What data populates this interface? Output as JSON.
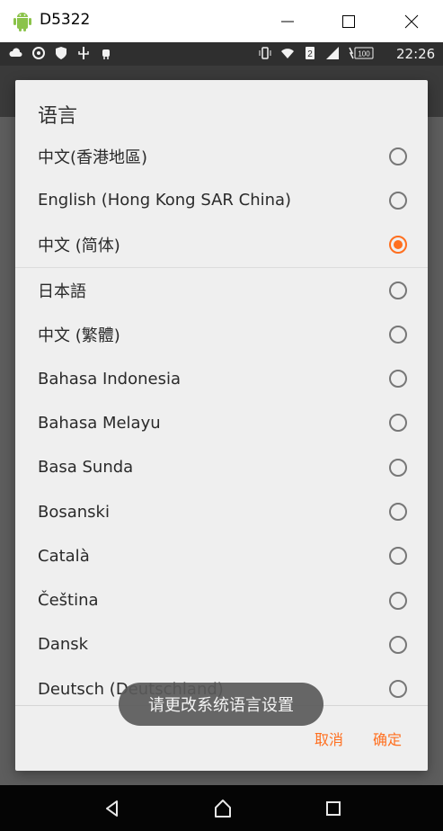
{
  "window": {
    "title": "D5322"
  },
  "status_bar": {
    "clock": "22:26",
    "sim_slot": "2",
    "battery": "100",
    "left_icons": [
      "cloud-icon",
      "sync-icon",
      "shield-icon",
      "usb-icon",
      "android-debug-icon"
    ],
    "right_icons": [
      "vibrate-icon",
      "wifi-icon",
      "sim-icon",
      "signal-icon",
      "battery-icon"
    ]
  },
  "dialog": {
    "title": "语言",
    "options": [
      {
        "label": "中文(香港地區)",
        "selected": false
      },
      {
        "label": "English (Hong Kong SAR China)",
        "selected": false
      },
      {
        "label": "中文 (简体)",
        "selected": true
      },
      {
        "label": "日本語",
        "selected": false
      },
      {
        "label": "中文 (繁體)",
        "selected": false
      },
      {
        "label": "Bahasa Indonesia",
        "selected": false
      },
      {
        "label": "Bahasa Melayu",
        "selected": false
      },
      {
        "label": "Basa Sunda",
        "selected": false
      },
      {
        "label": "Bosanski",
        "selected": false
      },
      {
        "label": "Català",
        "selected": false
      },
      {
        "label": "Čeština",
        "selected": false
      },
      {
        "label": "Dansk",
        "selected": false
      },
      {
        "label": "Deutsch (Deutschland)",
        "selected": false
      }
    ],
    "cancel_label": "取消",
    "ok_label": "确定"
  },
  "toast": {
    "text": "请更改系统语言设置"
  },
  "colors": {
    "accent": "#ff6f1f",
    "dialog_bg": "#efefef",
    "status_bar_bg": "#2f2f2f"
  }
}
